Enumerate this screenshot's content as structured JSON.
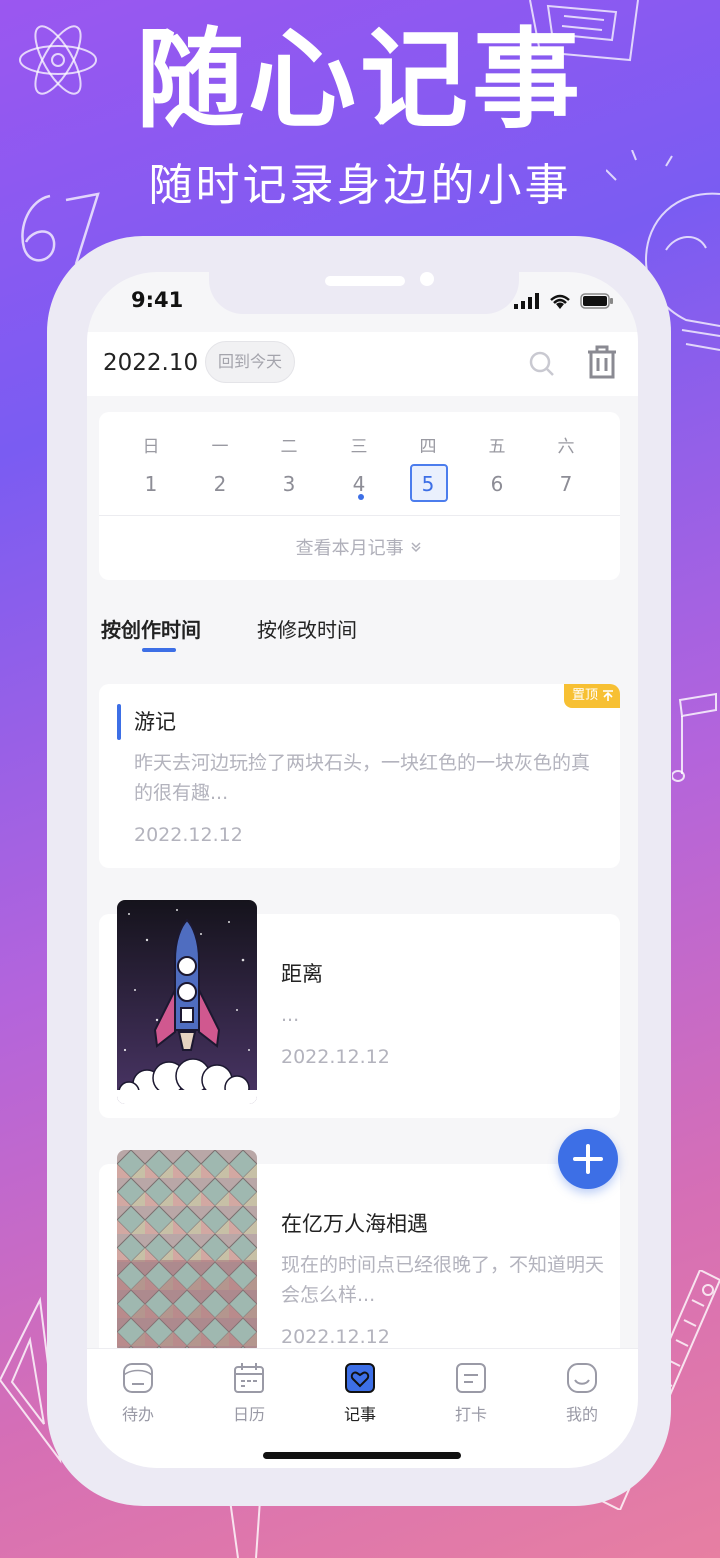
{
  "poster": {
    "title": "随心记事",
    "subtitle": "随时记录身边的小事"
  },
  "status_bar": {
    "time": "9:41",
    "icons": [
      "signal-icon",
      "wifi-icon",
      "battery-icon"
    ]
  },
  "header": {
    "month": "2022.10",
    "today_button": "回到今天",
    "icons": [
      "search-icon",
      "trash-icon"
    ]
  },
  "calendar": {
    "weekdays": [
      "日",
      "一",
      "二",
      "三",
      "四",
      "五",
      "六"
    ],
    "days": [
      "1",
      "2",
      "3",
      "4",
      "5",
      "6",
      "7"
    ],
    "selected_day": "5",
    "marked_day": "4",
    "view_month_link": "查看本月记事"
  },
  "sort_tabs": {
    "active": "按创作时间",
    "other": "按修改时间"
  },
  "notes": [
    {
      "title": "游记",
      "excerpt": "昨天去河边玩捡了两块石头，一块红色的一块灰色的真的很有趣...",
      "date": "2022.12.12",
      "badge": "置顶"
    },
    {
      "title": "距离",
      "excerpt": "...",
      "date": "2022.12.12",
      "image": "rocket-illustration"
    },
    {
      "title": "在亿万人海相遇",
      "excerpt": "现在的时间点已经很晚了，不知道明天会怎么样...",
      "date": "2022.12.12",
      "image": "colorful-scales-texture"
    }
  ],
  "fab": {
    "icon": "plus-icon"
  },
  "tab_bar": {
    "items": [
      {
        "label": "待办",
        "icon": "todo-icon"
      },
      {
        "label": "日历",
        "icon": "calendar-icon"
      },
      {
        "label": "记事",
        "icon": "notes-icon",
        "active": true
      },
      {
        "label": "打卡",
        "icon": "checkin-icon"
      },
      {
        "label": "我的",
        "icon": "profile-icon"
      }
    ]
  },
  "colors": {
    "accent": "#3d6fe6",
    "pin": "#f7c033"
  }
}
